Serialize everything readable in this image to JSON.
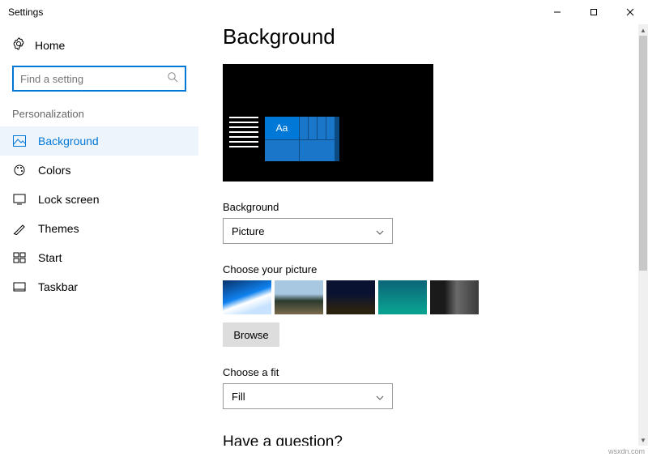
{
  "window": {
    "title": "Settings"
  },
  "sidebar": {
    "home": "Home",
    "search_placeholder": "Find a setting",
    "section": "Personalization",
    "items": [
      {
        "label": "Background"
      },
      {
        "label": "Colors"
      },
      {
        "label": "Lock screen"
      },
      {
        "label": "Themes"
      },
      {
        "label": "Start"
      },
      {
        "label": "Taskbar"
      }
    ]
  },
  "page": {
    "title": "Background",
    "preview_tile_text": "Aa",
    "background_label": "Background",
    "background_value": "Picture",
    "choose_picture_label": "Choose your picture",
    "browse_label": "Browse",
    "fit_label": "Choose a fit",
    "fit_value": "Fill",
    "question_heading": "Have a question?"
  },
  "watermark": "wsxdn.com"
}
